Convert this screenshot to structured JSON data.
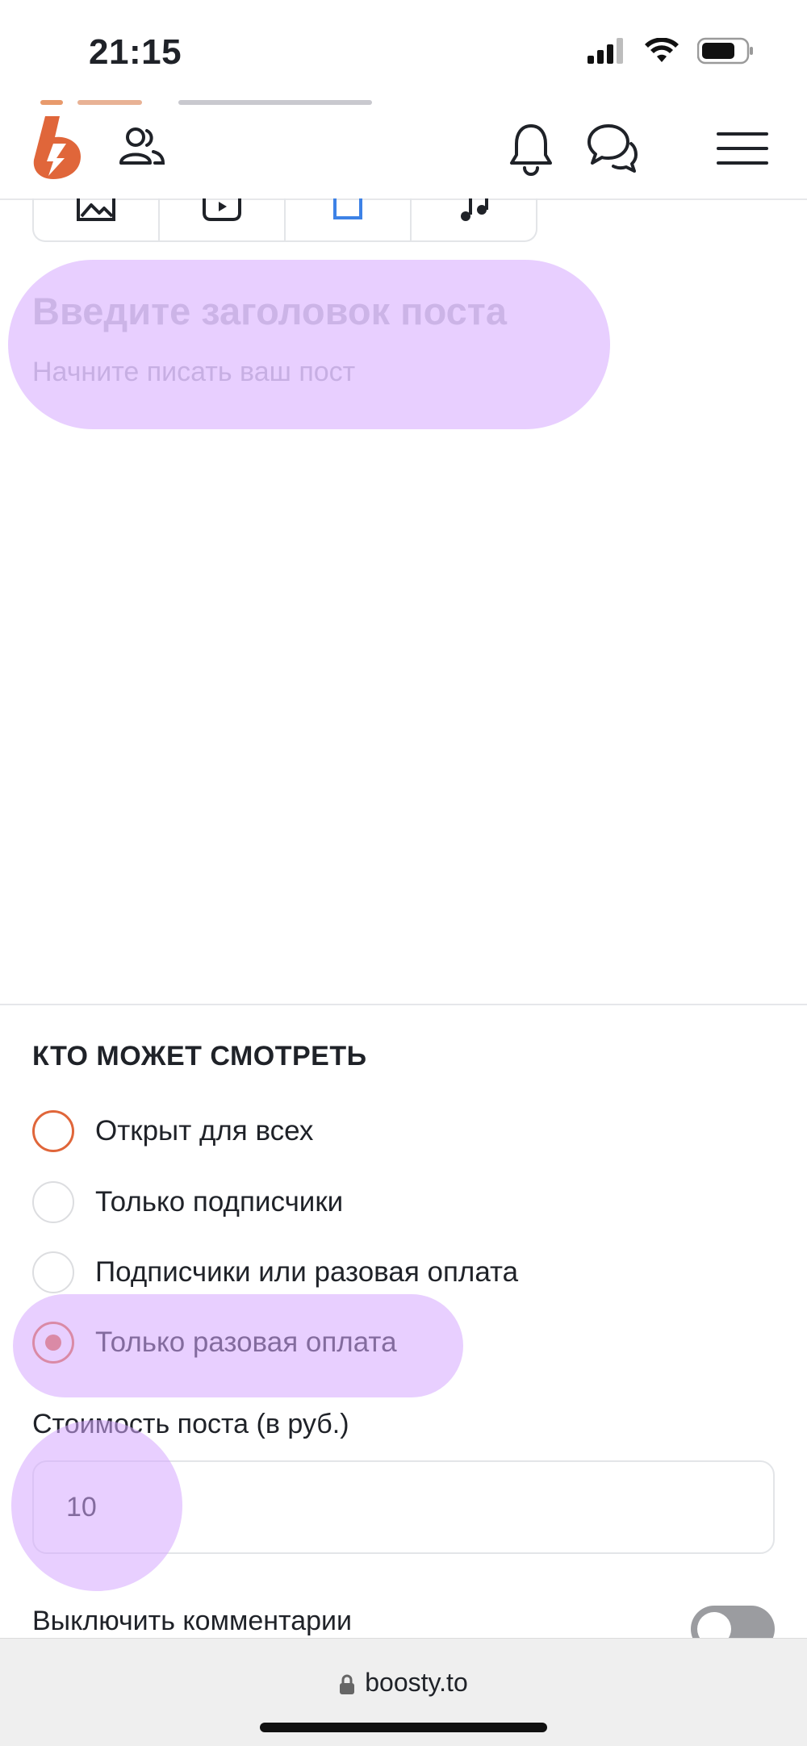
{
  "status_bar": {
    "time": "21:15"
  },
  "header": {
    "logo": "boosty-logo",
    "icons": [
      "people-icon",
      "bell-icon",
      "chat-icon",
      "menu-icon"
    ]
  },
  "toolbar": {
    "icons": [
      "image-icon",
      "video-icon",
      "file-icon",
      "music-icon"
    ]
  },
  "editor": {
    "title_placeholder": "Введите заголовок поста",
    "body_placeholder": "Начните писать ваш пост"
  },
  "visibility": {
    "title": "КТО МОЖЕТ СМОТРЕТЬ",
    "options": [
      {
        "label": "Открыт для всех",
        "state": "hover"
      },
      {
        "label": "Только подписчики",
        "state": "unchecked"
      },
      {
        "label": "Подписчики или разовая оплата",
        "state": "unchecked"
      },
      {
        "label": "Только разовая оплата",
        "state": "checked"
      }
    ]
  },
  "price": {
    "label": "Стоимость поста (в руб.)",
    "value": "10"
  },
  "comments": {
    "label": "Выключить комментарии",
    "enabled": false
  },
  "browser": {
    "url": "boosty.to"
  },
  "colors": {
    "accent": "#e0663a",
    "highlight": "#d6a8ff",
    "placeholder": "#c2c4cb"
  }
}
